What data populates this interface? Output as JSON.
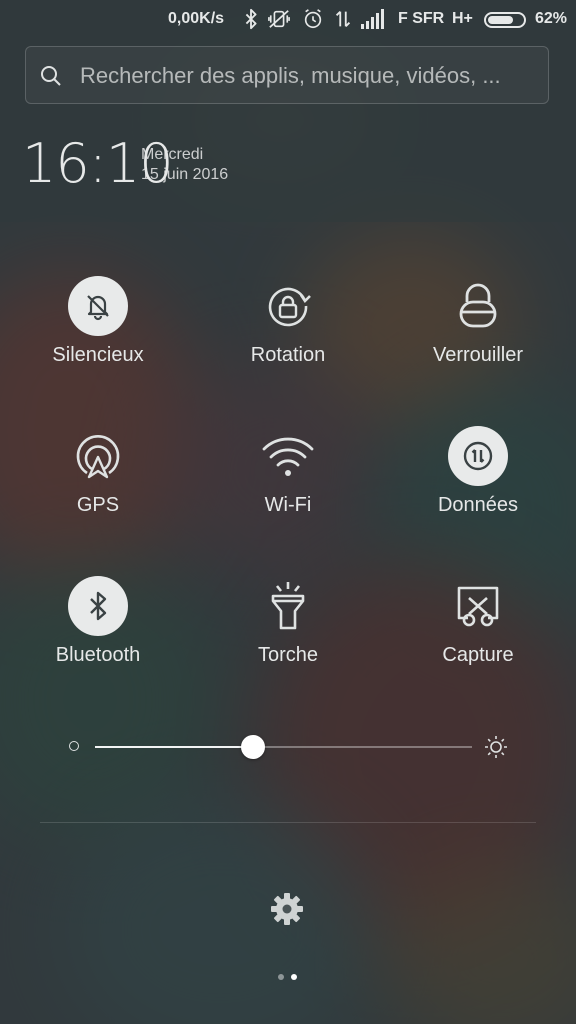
{
  "status_bar": {
    "speed": "0,00K/s",
    "carrier": "F SFR",
    "network_type": "H+",
    "battery": "62%",
    "icons": [
      "bluetooth-icon",
      "vibrate-off-icon",
      "alarm-icon",
      "data-transfer-icon",
      "signal-icon",
      "battery-icon"
    ]
  },
  "search": {
    "placeholder": "Rechercher des applis, musique, vidéos, ..."
  },
  "clock": {
    "time": "16:10",
    "day": "Mercredi",
    "date": "15 juin 2016"
  },
  "toggles": [
    {
      "label": "Silencieux",
      "icon": "bell-off-icon",
      "active": true
    },
    {
      "label": "Rotation",
      "icon": "rotation-lock-icon",
      "active": false
    },
    {
      "label": "Verrouiller",
      "icon": "lock-icon",
      "active": false
    },
    {
      "label": "GPS",
      "icon": "gps-icon",
      "active": false
    },
    {
      "label": "Wi-Fi",
      "icon": "wifi-icon",
      "active": false
    },
    {
      "label": "Données",
      "icon": "data-icon",
      "active": true
    },
    {
      "label": "Bluetooth",
      "icon": "bluetooth-icon",
      "active": true
    },
    {
      "label": "Torche",
      "icon": "flashlight-icon",
      "active": false
    },
    {
      "label": "Capture",
      "icon": "screenshot-icon",
      "active": false
    }
  ],
  "brightness": {
    "level": 0.42
  },
  "pager": {
    "pages": 2,
    "current": 2
  },
  "colors": {
    "active_circle": "#e8eaea",
    "active_icon": "#3a4244",
    "text": "#e6e8e8"
  }
}
